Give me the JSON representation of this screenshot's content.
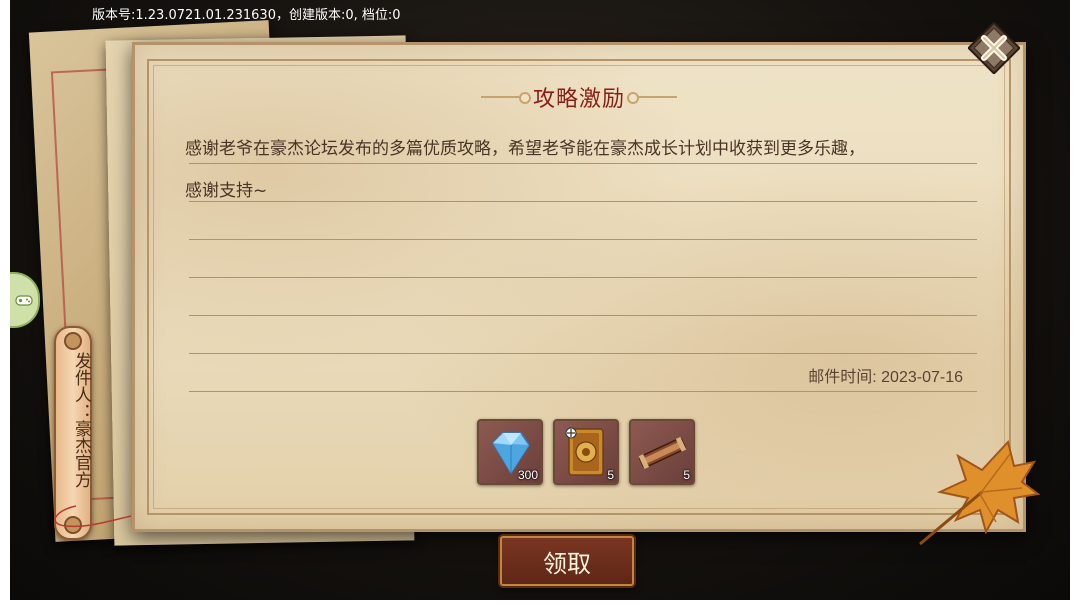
{
  "header": {
    "version_text": "版本号:1.23.0721.01.231630，创建版本:0, 档位:0"
  },
  "mail": {
    "title": "攻略激励",
    "body_line_1": "感谢老爷在豪杰论坛发布的多篇优质攻略，希望老爷能在豪杰成长计划中收获到更多乐趣，",
    "body_line_2": "感谢支持~",
    "time_label": "邮件时间: 2023-07-16",
    "sender": "发件人：豪杰官方",
    "rewards": [
      {
        "icon": "diamond-icon",
        "count": "300"
      },
      {
        "icon": "card-icon",
        "count": "5"
      },
      {
        "icon": "scroll-chest-icon",
        "count": "5"
      }
    ],
    "claim_label": "领取"
  },
  "colors": {
    "title": "#8a1e17",
    "paper": "#efe3c7",
    "claim_button": "#6b2d1b"
  }
}
